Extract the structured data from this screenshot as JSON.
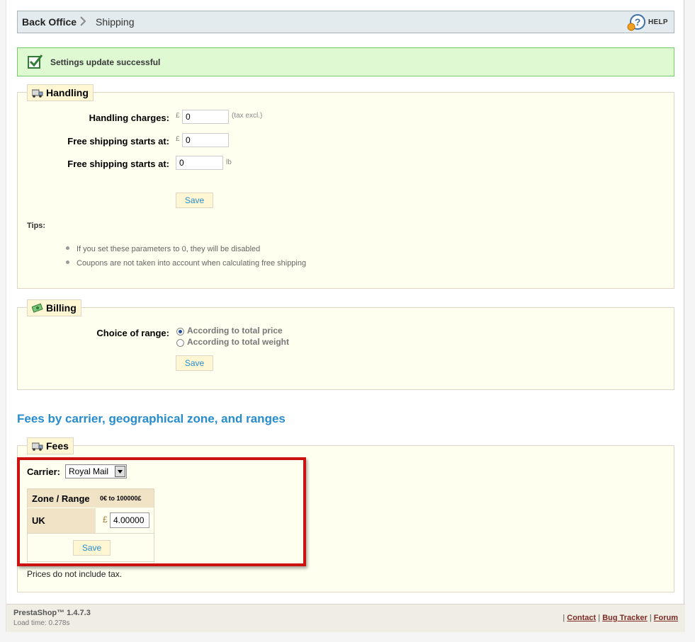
{
  "breadcrumb": {
    "root": "Back Office",
    "current": "Shipping",
    "help_label": "HELP"
  },
  "alert": {
    "message": "Settings update successful"
  },
  "handling": {
    "legend": "Handling",
    "handling_charges_label": "Handling charges:",
    "handling_charges_currency": "£",
    "handling_charges_value": "0",
    "handling_charges_note": "(tax excl.)",
    "free_price_label": "Free shipping starts at:",
    "free_price_currency": "£",
    "free_price_value": "0",
    "free_weight_label": "Free shipping starts at:",
    "free_weight_value": "0",
    "free_weight_unit": "lb",
    "save_label": "Save",
    "tips_heading": "Tips:",
    "tips": [
      "If you set these parameters to 0, they will be disabled",
      "Coupons are not taken into account when calculating free shipping"
    ]
  },
  "billing": {
    "legend": "Billing",
    "choice_label": "Choice of range:",
    "options": [
      {
        "label": "According to total price",
        "selected": true
      },
      {
        "label": "According to total weight",
        "selected": false
      }
    ],
    "save_label": "Save"
  },
  "fees_title": "Fees by carrier, geographical zone, and ranges",
  "fees": {
    "legend": "Fees",
    "carrier_label": "Carrier:",
    "carrier_selected": "Royal Mail",
    "table": {
      "header_zone": "Zone / Range",
      "header_range": "0€ to 100000£",
      "rows": [
        {
          "zone": "UK",
          "currency": "£",
          "value": "4.00000"
        }
      ]
    },
    "save_label": "Save",
    "note": "Prices do not include tax."
  },
  "footer": {
    "version": "PrestaShop™ 1.4.7.3",
    "load_time": "Load time: 0.278s",
    "links": [
      "Contact",
      "Bug Tracker",
      "Forum"
    ]
  },
  "colors": {
    "accent": "#268ccd",
    "highlight_border": "#cc1111",
    "panel_bg": "#fffff0",
    "legend_bg": "#fff6d3"
  }
}
